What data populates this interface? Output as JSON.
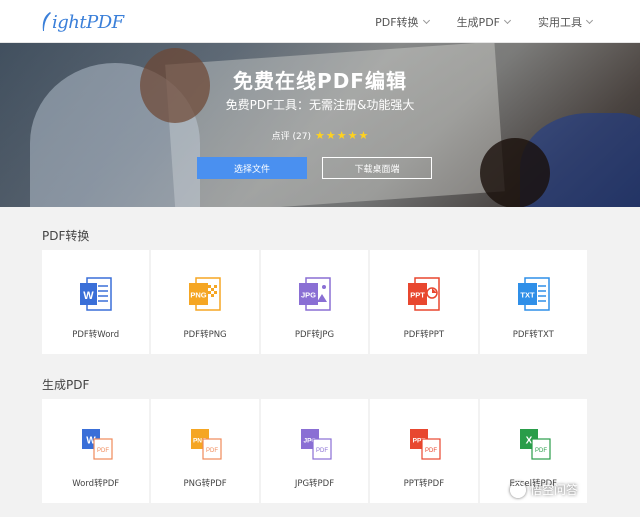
{
  "header": {
    "logo_text": "ightPDF",
    "nav": [
      {
        "label": "PDF转换"
      },
      {
        "label": "生成PDF"
      },
      {
        "label": "实用工具"
      }
    ]
  },
  "hero": {
    "title": "免费在线PDF编辑",
    "subtitle": "免费PDF工具：无需注册&功能强大",
    "rating_label": "点评 (27)",
    "stars": 5,
    "primary_button": "选择文件",
    "secondary_button": "下载桌面端"
  },
  "sections": [
    {
      "title": "PDF转换",
      "items": [
        {
          "label": "PDF转Word",
          "badge": "W",
          "color": "#3a6fd8"
        },
        {
          "label": "PDF转PNG",
          "badge": "PNG",
          "color": "#f5a623"
        },
        {
          "label": "PDF转JPG",
          "badge": "JPG",
          "color": "#8a6fd4"
        },
        {
          "label": "PDF转PPT",
          "badge": "PPT",
          "color": "#e8472f"
        },
        {
          "label": "PDF转TXT",
          "badge": "TXT",
          "color": "#2f8fe8"
        }
      ]
    },
    {
      "title": "生成PDF",
      "items": [
        {
          "label": "Word转PDF",
          "badge": "W",
          "color": "#3a6fd8"
        },
        {
          "label": "PNG转PDF",
          "badge": "PNG",
          "color": "#f5a623"
        },
        {
          "label": "JPG转PDF",
          "badge": "JPG",
          "color": "#8a6fd4"
        },
        {
          "label": "PPT转PDF",
          "badge": "PPT",
          "color": "#e8472f"
        },
        {
          "label": "Excel转PDF",
          "badge": "X",
          "color": "#2a9d4a"
        }
      ]
    }
  ],
  "colors": {
    "brand": "#3a7fd9",
    "primary_button": "#4a90f0",
    "star": "#ffd21f",
    "pdf_badge": "#f08a5a"
  },
  "watermark": {
    "text": "悟空问答"
  }
}
